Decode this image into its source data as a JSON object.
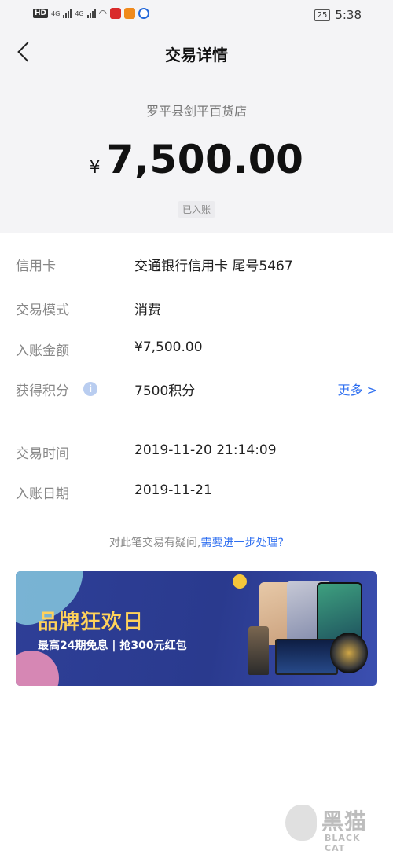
{
  "status_bar": {
    "hd": "HD",
    "net1": "4G",
    "net2": "4G",
    "battery": "25",
    "time": "5:38"
  },
  "header": {
    "title": "交易详情"
  },
  "summary": {
    "merchant": "罗平县剑平百货店",
    "currency_symbol": "¥",
    "amount": "7,500.00",
    "status": "已入账"
  },
  "details": {
    "card_label": "信用卡",
    "card_value": "交通银行信用卡 尾号5467",
    "mode_label": "交易模式",
    "mode_value": "消费",
    "posted_amount_label": "入账金额",
    "posted_amount_value": "¥7,500.00",
    "points_label": "获得积分",
    "points_value": "7500积分",
    "more_label": "更多 >",
    "time_label": "交易时间",
    "time_value": "2019-11-20 21:14:09",
    "post_date_label": "入账日期",
    "post_date_value": "2019-11-21"
  },
  "help": {
    "prefix": "对此笔交易有疑问,",
    "link": "需要进一步处理?"
  },
  "banner": {
    "title": "品牌狂欢日",
    "subtitle": "最高24期免息 | 抢300元红包"
  },
  "watermark": {
    "cn": "黑猫",
    "en": "BLACK CAT"
  },
  "colors": {
    "accent": "#2d6ef0",
    "banner_bg": "#2e3f97",
    "banner_title": "#ffd25a"
  }
}
